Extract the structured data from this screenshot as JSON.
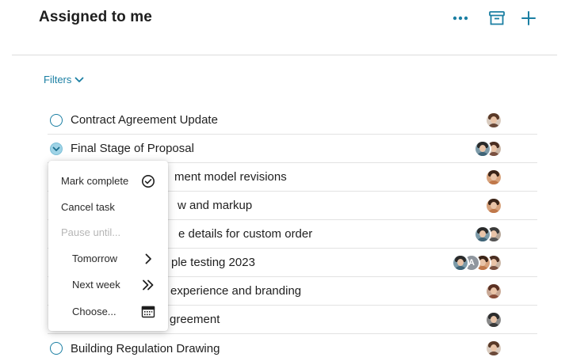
{
  "header": {
    "title": "Assigned to me",
    "more_icon": "more-horizontal-icon",
    "archive_icon": "archive-icon",
    "add_icon": "plus-icon"
  },
  "filters": {
    "label": "Filters",
    "icon": "chevron-down-icon"
  },
  "tasks": [
    {
      "title": "Contract Agreement Update",
      "avatars": 1
    },
    {
      "title": "Final Stage of Proposal",
      "avatars": 2
    },
    {
      "title": "ment model revisions",
      "avatars": 1
    },
    {
      "title": "w and markup",
      "avatars": 1
    },
    {
      "title": "e details for custom order",
      "avatars": 2
    },
    {
      "title": "ple testing 2023",
      "avatars": 4,
      "avatar_letter": "A"
    },
    {
      "title": "experience and branding",
      "avatars": 1
    },
    {
      "title": "greement",
      "avatars": 1
    },
    {
      "title": "Building Regulation Drawing",
      "avatars": 1
    }
  ],
  "context_menu": {
    "mark_complete": "Mark complete",
    "cancel_task": "Cancel task",
    "pause_until": "Pause until...",
    "tomorrow": "Tomorrow",
    "next_week": "Next week",
    "choose": "Choose..."
  },
  "colors": {
    "accent": "#1b7fa3",
    "divider": "#e2e2e2",
    "disabled": "#b6b6b6"
  }
}
